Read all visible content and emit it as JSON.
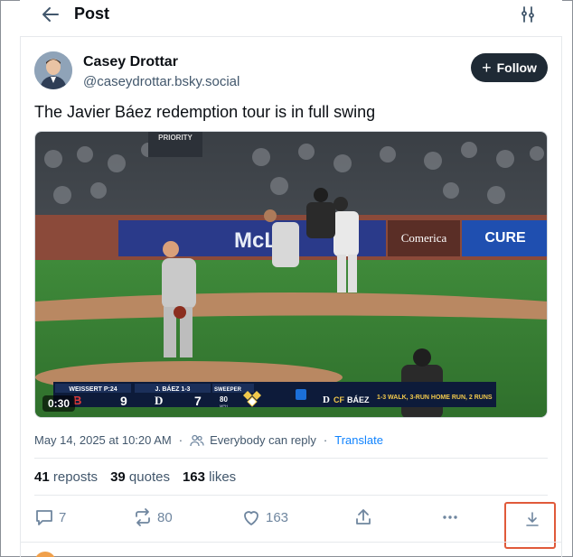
{
  "header": {
    "title": "Post"
  },
  "post": {
    "author_name": "Casey Drottar",
    "author_handle": "@caseydrottar.bsky.social",
    "follow_label": "Follow",
    "text": "The Javier Báez redemption tour is in full swing",
    "video": {
      "duration": "0:30",
      "ad_boards": [
        "PRIORITY",
        "Comerica",
        "CURE",
        "McL"
      ],
      "scorebug": {
        "pitcher": "WEISSERT P:24",
        "batter": "J. BÁEZ 1-3",
        "pitch_type": "SWEEPER",
        "pitch_speed": "80",
        "pitch_unit": "MPH",
        "away_score": "9",
        "home_score": "7",
        "position": "CF",
        "batter_name": "BÁEZ",
        "stat_line": "1-3 WALK, 3-RUN HOME RUN, 2 RUNS"
      }
    },
    "timestamp": "May 14, 2025 at 10:20 AM",
    "audience": "Everybody can reply",
    "translate": "Translate",
    "stats": {
      "reposts_count": "41",
      "reposts_label": "reposts",
      "quotes_count": "39",
      "quotes_label": "quotes",
      "likes_count": "163",
      "likes_label": "likes"
    },
    "actions": {
      "replies": "7",
      "reposts": "80",
      "likes": "163"
    }
  },
  "colors": {
    "follow_bg": "#1f2a35",
    "link": "#1083fe",
    "highlight": "#e05a3a"
  }
}
